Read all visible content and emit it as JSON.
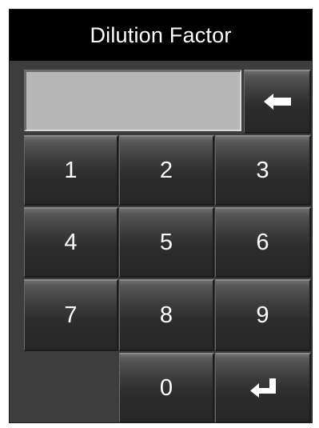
{
  "dialog": {
    "title": "Dilution Factor",
    "input_value": ""
  },
  "keypad": {
    "k1": "1",
    "k2": "2",
    "k3": "3",
    "k4": "4",
    "k5": "5",
    "k6": "6",
    "k7": "7",
    "k8": "8",
    "k9": "9",
    "k0": "0",
    "backspace_icon": "left-arrow-icon",
    "enter_icon": "enter-return-icon"
  },
  "colors": {
    "title_bar": "#000000",
    "title_text": "#ffffff",
    "frame": "#3d3d3d",
    "display_field": "#b7b7b7",
    "key_top": "#6f6f6f",
    "key_bottom": "#262626",
    "key_text": "#ffffff"
  }
}
